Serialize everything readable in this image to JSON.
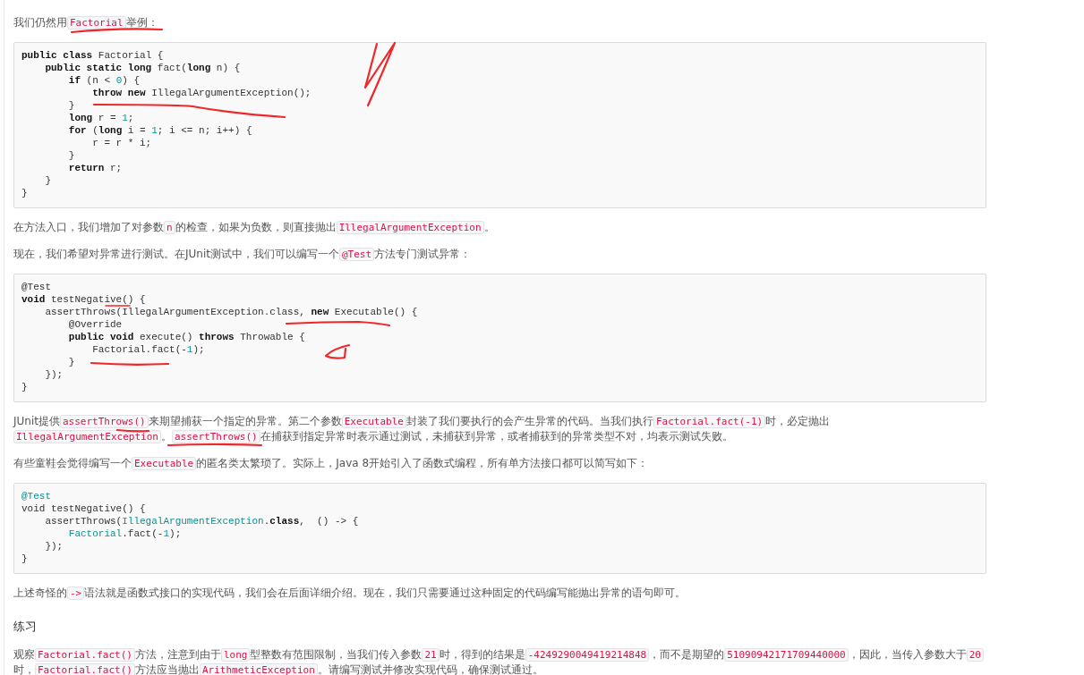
{
  "content": [
    {
      "kind": "paragraph",
      "parts": [
        {
          "kind": "text",
          "t": "我们仍然用"
        },
        {
          "kind": "code",
          "t": "Factorial"
        },
        {
          "kind": "text",
          "t": "举例："
        }
      ]
    },
    {
      "kind": "codeblock",
      "lines": [
        [
          {
            "kind": "kw",
            "t": "public class"
          },
          {
            "kind": "plain",
            "t": " Factorial {"
          }
        ],
        [
          {
            "kind": "kw",
            "t": "    public static long"
          },
          {
            "kind": "plain",
            "t": " fact("
          },
          {
            "kind": "kw",
            "t": "long"
          },
          {
            "kind": "plain",
            "t": " n) {"
          }
        ],
        [
          {
            "kind": "kw",
            "t": "        if"
          },
          {
            "kind": "plain",
            "t": " (n < "
          },
          {
            "kind": "num",
            "t": "0"
          },
          {
            "kind": "plain",
            "t": ") {"
          }
        ],
        [
          {
            "kind": "kw",
            "t": "            throw new"
          },
          {
            "kind": "plain",
            "t": " IllegalArgumentException();"
          }
        ],
        [
          {
            "kind": "plain",
            "t": "        }"
          }
        ],
        [
          {
            "kind": "kw",
            "t": "        long"
          },
          {
            "kind": "plain",
            "t": " r = "
          },
          {
            "kind": "num",
            "t": "1"
          },
          {
            "kind": "plain",
            "t": ";"
          }
        ],
        [
          {
            "kind": "kw",
            "t": "        for"
          },
          {
            "kind": "plain",
            "t": " ("
          },
          {
            "kind": "kw",
            "t": "long"
          },
          {
            "kind": "plain",
            "t": " i = "
          },
          {
            "kind": "num",
            "t": "1"
          },
          {
            "kind": "plain",
            "t": "; i <= n; i++) {"
          }
        ],
        [
          {
            "kind": "plain",
            "t": "            r = r * i;"
          }
        ],
        [
          {
            "kind": "plain",
            "t": "        }"
          }
        ],
        [
          {
            "kind": "kw",
            "t": "        return"
          },
          {
            "kind": "plain",
            "t": " r;"
          }
        ],
        [
          {
            "kind": "plain",
            "t": "    }"
          }
        ],
        [
          {
            "kind": "plain",
            "t": "}"
          }
        ]
      ]
    },
    {
      "kind": "paragraph",
      "parts": [
        {
          "kind": "text",
          "t": "在方法入口，我们增加了对参数"
        },
        {
          "kind": "code",
          "t": "n"
        },
        {
          "kind": "text",
          "t": "的检查，如果为负数，则直接抛出"
        },
        {
          "kind": "code",
          "t": "IllegalArgumentException"
        },
        {
          "kind": "text",
          "t": "。"
        }
      ]
    },
    {
      "kind": "paragraph",
      "parts": [
        {
          "kind": "text",
          "t": "现在，我们希望对异常进行测试。在JUnit测试中，我们可以编写一个"
        },
        {
          "kind": "code",
          "t": "@Test"
        },
        {
          "kind": "text",
          "t": "方法专门测试异常："
        }
      ]
    },
    {
      "kind": "codeblock",
      "lines": [
        [
          {
            "kind": "plain",
            "t": "@Test"
          }
        ],
        [
          {
            "kind": "kw",
            "t": "void"
          },
          {
            "kind": "plain",
            "t": " testNegative() {"
          }
        ],
        [
          {
            "kind": "plain",
            "t": "    assertThrows(IllegalArgumentException.class, "
          },
          {
            "kind": "kw",
            "t": "new"
          },
          {
            "kind": "plain",
            "t": " Executable() {"
          }
        ],
        [
          {
            "kind": "plain",
            "t": "        @Override"
          }
        ],
        [
          {
            "kind": "kw",
            "t": "        public void"
          },
          {
            "kind": "plain",
            "t": " execute() "
          },
          {
            "kind": "kw",
            "t": "throws"
          },
          {
            "kind": "plain",
            "t": " Throwable {"
          }
        ],
        [
          {
            "kind": "plain",
            "t": "            Factorial.fact(-"
          },
          {
            "kind": "num",
            "t": "1"
          },
          {
            "kind": "plain",
            "t": ");"
          }
        ],
        [
          {
            "kind": "plain",
            "t": "        }"
          }
        ],
        [
          {
            "kind": "plain",
            "t": "    });"
          }
        ],
        [
          {
            "kind": "plain",
            "t": "}"
          }
        ]
      ]
    },
    {
      "kind": "paragraph",
      "parts": [
        {
          "kind": "text",
          "t": "JUnit提供"
        },
        {
          "kind": "code",
          "t": "assertThrows()"
        },
        {
          "kind": "text",
          "t": "来期望捕获一个指定的异常。第二个参数"
        },
        {
          "kind": "code",
          "t": "Executable"
        },
        {
          "kind": "text",
          "t": "封装了我们要执行的会产生异常的代码。当我们执行"
        },
        {
          "kind": "code",
          "t": "Factorial.fact(-1)"
        },
        {
          "kind": "text",
          "t": "时，必定抛出"
        },
        {
          "kind": "code",
          "t": "IllegalArgumentException"
        },
        {
          "kind": "text",
          "t": "。"
        },
        {
          "kind": "code",
          "t": "assertThrows()"
        },
        {
          "kind": "text",
          "t": "在捕获到指定异常时表示通过测试，未捕获到异常，或者捕获到的异常类型不对，均表示测试失败。"
        }
      ]
    },
    {
      "kind": "paragraph",
      "parts": [
        {
          "kind": "text",
          "t": "有些童鞋会觉得编写一个"
        },
        {
          "kind": "code",
          "t": "Executable"
        },
        {
          "kind": "text",
          "t": "的匿名类太繁琐了。实际上，Java 8开始引入了函数式编程，所有单方法接口都可以简写如下："
        }
      ]
    },
    {
      "kind": "codeblock",
      "lines": [
        [
          {
            "kind": "type",
            "t": "@Test"
          }
        ],
        [
          {
            "kind": "plain",
            "t": "void testNegative() {"
          }
        ],
        [
          {
            "kind": "plain",
            "t": "    assertThrows("
          },
          {
            "kind": "type",
            "t": "IllegalArgumentException"
          },
          {
            "kind": "plain",
            "t": "."
          },
          {
            "kind": "kw",
            "t": "class"
          },
          {
            "kind": "plain",
            "t": ",  () -> {"
          }
        ],
        [
          {
            "kind": "type",
            "t": "        Factorial"
          },
          {
            "kind": "plain",
            "t": ".fact(-"
          },
          {
            "kind": "num",
            "t": "1"
          },
          {
            "kind": "plain",
            "t": ");"
          }
        ],
        [
          {
            "kind": "plain",
            "t": "    });"
          }
        ],
        [
          {
            "kind": "plain",
            "t": "}"
          }
        ]
      ]
    },
    {
      "kind": "paragraph",
      "parts": [
        {
          "kind": "text",
          "t": "上述奇怪的"
        },
        {
          "kind": "code",
          "t": "->"
        },
        {
          "kind": "text",
          "t": "语法就是函数式接口的实现代码，我们会在后面详细介绍。现在，我们只需要通过这种固定的代码编写能抛出异常的语句即可。"
        }
      ]
    },
    {
      "kind": "heading",
      "t": "练习"
    },
    {
      "kind": "paragraph",
      "parts": [
        {
          "kind": "text",
          "t": "观察"
        },
        {
          "kind": "code",
          "t": "Factorial.fact()"
        },
        {
          "kind": "text",
          "t": "方法，注意到由于"
        },
        {
          "kind": "code",
          "t": "long"
        },
        {
          "kind": "text",
          "t": "型整数有范围限制，当我们传入参数"
        },
        {
          "kind": "code",
          "t": "21"
        },
        {
          "kind": "text",
          "t": "时，得到的结果是"
        },
        {
          "kind": "code",
          "t": "-4249290049419214848"
        },
        {
          "kind": "text",
          "t": "，而不是期望的"
        },
        {
          "kind": "code",
          "t": "51090942171709440000"
        },
        {
          "kind": "text",
          "t": "，因此，当传入参数大于"
        },
        {
          "kind": "code",
          "t": "20"
        },
        {
          "kind": "text",
          "t": "时，"
        },
        {
          "kind": "code",
          "t": "Factorial.fact()"
        },
        {
          "kind": "text",
          "t": "方法应当抛出"
        },
        {
          "kind": "code",
          "t": "ArithmeticException"
        },
        {
          "kind": "text",
          "t": "。请编写测试并修改实现代码，确保测试通过。"
        }
      ]
    }
  ]
}
